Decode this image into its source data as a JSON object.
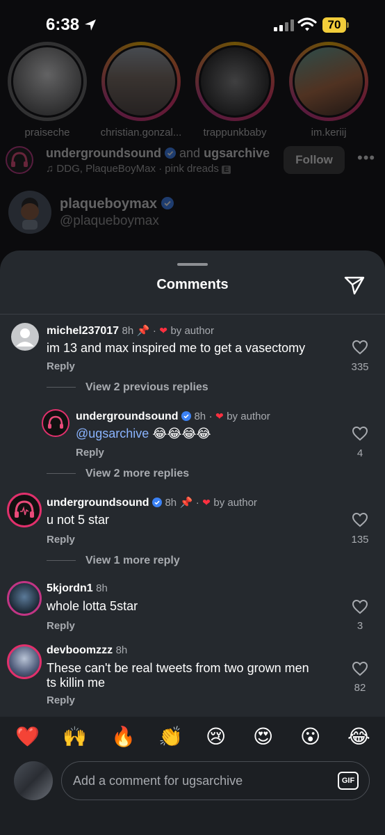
{
  "status_bar": {
    "time": "6:38",
    "battery": "70"
  },
  "stories": [
    {
      "name": "praiseche",
      "ring": "gray"
    },
    {
      "name": "christian.gonzal...",
      "ring": "gradient"
    },
    {
      "name": "trappunkbaby",
      "ring": "gradient"
    },
    {
      "name": "im.keriij",
      "ring": "gradient"
    }
  ],
  "post_header": {
    "author": "undergroundsound",
    "and_text": "and",
    "coauthor": "ugsarchive",
    "audio": "DDG, PlaqueBoyMax · pink dreads",
    "explicit_badge": "E",
    "follow_label": "Follow"
  },
  "tweet": {
    "name": "plaqueboymax",
    "handle": "@plaqueboymax"
  },
  "sheet": {
    "title": "Comments"
  },
  "comments": [
    {
      "user": "michel237017",
      "time": "8h",
      "pinned": true,
      "liked_by_author": "by author",
      "text": "im 13 and max inspired me to get a vasectomy",
      "reply_label": "Reply",
      "likes": "335",
      "view_replies": "View 2 previous replies"
    },
    {
      "user": "undergroundsound",
      "time": "8h",
      "pinned": false,
      "liked_by_author": "by author",
      "mention": "@ugsarchive",
      "text": "😂😂😂😂",
      "reply_label": "Reply",
      "likes": "4",
      "view_replies": "View 2 more replies"
    },
    {
      "user": "undergroundsound",
      "time": "8h",
      "pinned": true,
      "liked_by_author": "by author",
      "text": "u not 5 star",
      "reply_label": "Reply",
      "likes": "135",
      "view_replies": "View 1 more reply"
    },
    {
      "user": "5kjordn1",
      "time": "8h",
      "text": "whole lotta 5star",
      "reply_label": "Reply",
      "likes": "3"
    },
    {
      "user": "devboomzzz",
      "time": "8h",
      "text_line1": "These can't be real tweets from two grown men",
      "text_line2": "ts killin me",
      "reply_label": "Reply",
      "likes": "82"
    }
  ],
  "quick_emojis": [
    "❤️",
    "🙌",
    "🔥",
    "👏",
    "😢",
    "😍",
    "😮",
    "😂"
  ],
  "composer": {
    "placeholder": "Add a comment for ugsarchive",
    "gif_label": "GIF"
  },
  "colors": {
    "sheet_bg": "#25292e",
    "verified": "#3b82f6",
    "heart_red": "#ff3040",
    "mention": "#8ab4ff",
    "battery": "#f2cd3a"
  },
  "icons": [
    "location-arrow-icon",
    "signal-icon",
    "wifi-icon",
    "verified-badge-icon",
    "pin-icon",
    "heart-icon",
    "share-send-icon",
    "music-note-icon",
    "more-icon"
  ]
}
